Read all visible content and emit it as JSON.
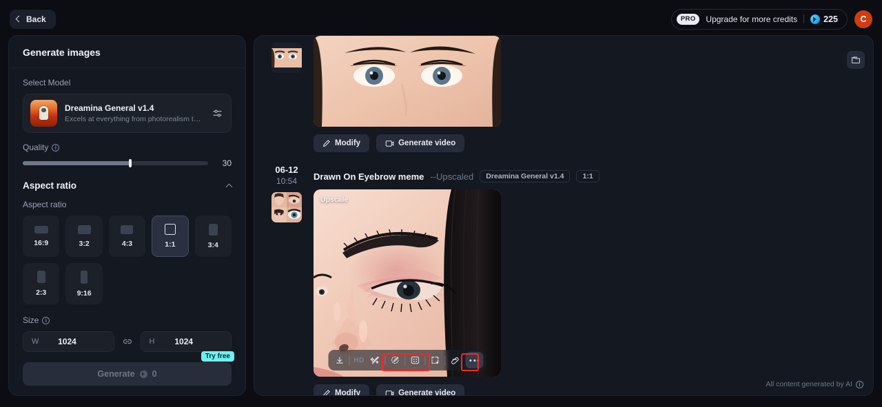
{
  "topbar": {
    "back_label": "Back",
    "upgrade_label": "Upgrade for more credits",
    "pro_badge": "PRO",
    "credits": "225",
    "avatar_initial": "C"
  },
  "left_panel": {
    "title": "Generate images",
    "select_model_label": "Select Model",
    "model": {
      "name": "Dreamina General v1.4",
      "description": "Excels at everything from photorealism to painterly style…"
    },
    "quality": {
      "label": "Quality",
      "value": "30",
      "fill_percent": 58
    },
    "aspect_section": {
      "title": "Aspect ratio",
      "subtitle": "Aspect ratio",
      "options": [
        {
          "label": "16:9",
          "w": 20,
          "h": 11,
          "selected": false
        },
        {
          "label": "3:2",
          "w": 19,
          "h": 13,
          "selected": false
        },
        {
          "label": "4:3",
          "w": 18,
          "h": 13,
          "selected": false
        },
        {
          "label": "1:1",
          "w": 16,
          "h": 16,
          "selected": true
        },
        {
          "label": "3:4",
          "w": 13,
          "h": 17,
          "selected": false
        },
        {
          "label": "2:3",
          "w": 12,
          "h": 18,
          "selected": false
        },
        {
          "label": "9:16",
          "w": 10,
          "h": 19,
          "selected": false
        }
      ]
    },
    "size": {
      "label": "Size",
      "width_key": "W",
      "width_value": "1024",
      "height_key": "H",
      "height_value": "1024"
    },
    "generate": {
      "label": "Generate",
      "cost": "0",
      "try_free_badge": "Try free"
    }
  },
  "main_panel": {
    "ai_note": "All content generated by AI",
    "results": [
      {
        "show_header": false,
        "date": "",
        "time": "",
        "title": "",
        "subtitle": "",
        "model_chip": "",
        "ratio_chip": "",
        "upscale_tag": "",
        "actions": [
          {
            "label": "Modify",
            "icon": "pencil-icon"
          },
          {
            "label": "Generate video",
            "icon": "video-icon"
          }
        ]
      },
      {
        "show_header": true,
        "date": "06-12",
        "time": "10:54",
        "title": "Drawn On Eyebrow meme",
        "subtitle": "--Upscaled",
        "model_chip": "Dreamina General v1.4",
        "ratio_chip": "1:1",
        "upscale_tag": "Upscale",
        "actions": [
          {
            "label": "Modify",
            "icon": "pencil-icon"
          },
          {
            "label": "Generate video",
            "icon": "video-icon"
          }
        ],
        "toolbar": {
          "hd_label": "HD",
          "items": [
            {
              "name": "download-icon"
            },
            {
              "name": "hd-label"
            },
            {
              "name": "magic-wand-icon"
            },
            {
              "name": "retouch-icon"
            },
            {
              "name": "inpaint-icon"
            },
            {
              "name": "expand-icon"
            },
            {
              "name": "eraser-icon"
            },
            {
              "name": "more-icon"
            }
          ]
        }
      }
    ]
  },
  "colors": {
    "accent_cyan": "#6ff0f0",
    "avatar_orange": "#cf3c12",
    "highlight_red": "#ee2b2b",
    "panel_bg": "#141821"
  }
}
